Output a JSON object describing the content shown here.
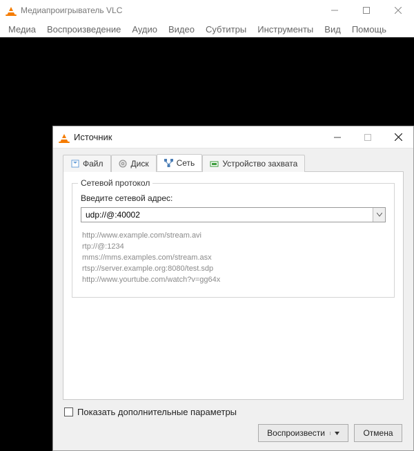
{
  "main": {
    "title": "Медиапроигрыватель VLC",
    "menubar": [
      "Медиа",
      "Воспроизведение",
      "Аудио",
      "Видео",
      "Субтитры",
      "Инструменты",
      "Вид",
      "Помощь"
    ]
  },
  "dialog": {
    "title": "Источник",
    "tabs": {
      "file": "Файл",
      "disc": "Диск",
      "network": "Сеть",
      "capture": "Устройство захвата"
    },
    "network": {
      "group_label": "Сетевой протокол",
      "addr_label": "Введите сетевой адрес:",
      "addr_value": "udp://@:40002",
      "examples": [
        "http://www.example.com/stream.avi",
        "rtp://@:1234",
        "mms://mms.examples.com/stream.asx",
        "rtsp://server.example.org:8080/test.sdp",
        "http://www.yourtube.com/watch?v=gg64x"
      ]
    },
    "show_more_label": "Показать дополнительные параметры",
    "play_button": "Воспроизвести",
    "cancel_button": "Отмена"
  }
}
